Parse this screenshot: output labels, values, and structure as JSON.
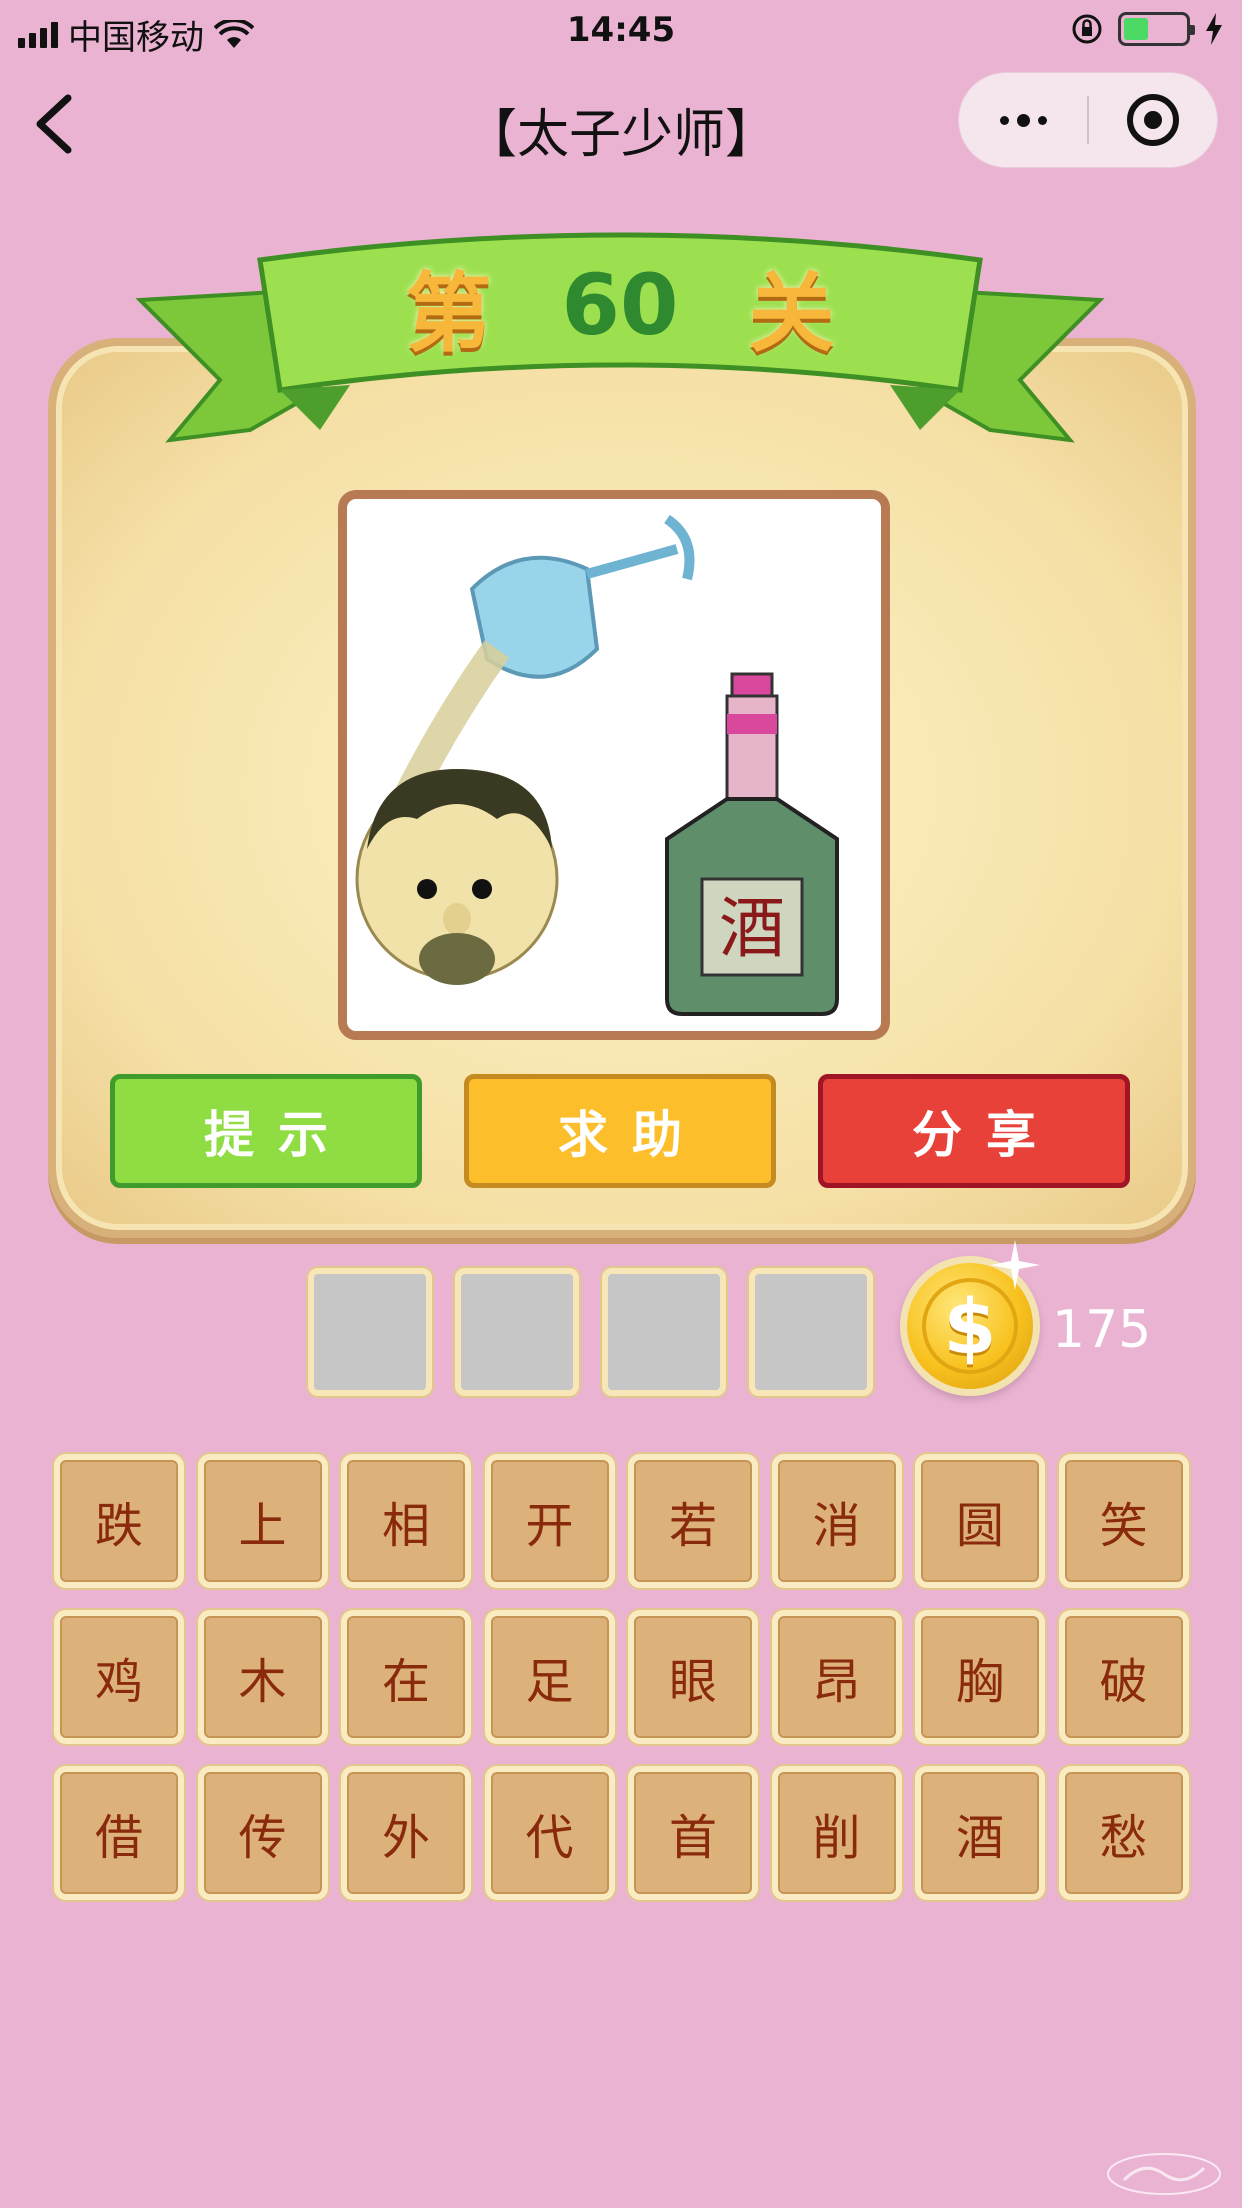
{
  "status_bar": {
    "carrier": "中国移动",
    "time": "14:45",
    "battery_level": 0.4
  },
  "nav": {
    "title": "【太子少师】",
    "back_icon": "chevron-left-icon",
    "more_icon": "more-dots-icon",
    "close_icon": "target-icon"
  },
  "level": {
    "prefix": "第",
    "number": "60",
    "suffix": "关"
  },
  "puzzle": {
    "bottle_label": "酒"
  },
  "actions": {
    "hint": "提示",
    "help": "求助",
    "share": "分享"
  },
  "coins": {
    "symbol": "$",
    "count": "175"
  },
  "answer_slots": [
    "",
    "",
    "",
    ""
  ],
  "letters": [
    "跌",
    "上",
    "相",
    "开",
    "若",
    "消",
    "圆",
    "笑",
    "鸡",
    "木",
    "在",
    "足",
    "眼",
    "昂",
    "胸",
    "破",
    "借",
    "传",
    "外",
    "代",
    "首",
    "削",
    "酒",
    "愁"
  ],
  "colors": {
    "background": "#ebb3d2",
    "hint_button": "#8fdc43",
    "help_button": "#fcbf2b",
    "share_button": "#e8413a",
    "tile": "#ddb27a",
    "tile_text": "#8a2a0c"
  }
}
